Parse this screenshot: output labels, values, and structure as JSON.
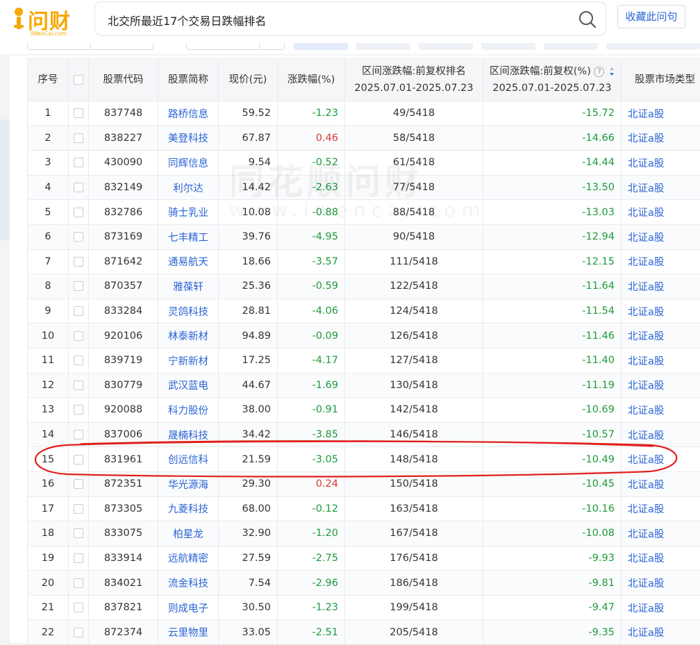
{
  "logo": {
    "text": "问财",
    "sub": "iWenCai.com"
  },
  "search": {
    "query": "北交所最近17个交易日跌幅排名"
  },
  "favorite_label": "收藏此问句",
  "table": {
    "headers": {
      "idx": "序号",
      "code": "股票代码",
      "name": "股票简称",
      "price": "现价(元)",
      "chg": "涨跌幅(%)",
      "rank_l1": "区间涨跌幅:前复权排名",
      "rank_l2": "2025.07.01-2025.07.23",
      "rng_l1": "区间涨跌幅:前复权(%)",
      "rng_l2": "2025.07.01-2025.07.23",
      "mkt": "股票市场类型"
    },
    "rows": [
      {
        "idx": "1",
        "code": "837748",
        "name": "路桥信息",
        "price": "59.52",
        "chg": "-1.23",
        "rank": "49/5418",
        "rng": "-15.72",
        "mkt": "北证a股"
      },
      {
        "idx": "2",
        "code": "838227",
        "name": "美登科技",
        "price": "67.87",
        "chg": "0.46",
        "rank": "58/5418",
        "rng": "-14.66",
        "mkt": "北证a股"
      },
      {
        "idx": "3",
        "code": "430090",
        "name": "同辉信息",
        "price": "9.54",
        "chg": "-0.52",
        "rank": "61/5418",
        "rng": "-14.44",
        "mkt": "北证a股"
      },
      {
        "idx": "4",
        "code": "832149",
        "name": "利尔达",
        "price": "14.42",
        "chg": "-2.63",
        "rank": "77/5418",
        "rng": "-13.50",
        "mkt": "北证a股"
      },
      {
        "idx": "5",
        "code": "832786",
        "name": "骑士乳业",
        "price": "10.08",
        "chg": "-0.88",
        "rank": "88/5418",
        "rng": "-13.03",
        "mkt": "北证a股"
      },
      {
        "idx": "6",
        "code": "873169",
        "name": "七丰精工",
        "price": "39.76",
        "chg": "-4.95",
        "rank": "90/5418",
        "rng": "-12.94",
        "mkt": "北证a股"
      },
      {
        "idx": "7",
        "code": "871642",
        "name": "通易航天",
        "price": "18.66",
        "chg": "-3.57",
        "rank": "111/5418",
        "rng": "-12.15",
        "mkt": "北证a股"
      },
      {
        "idx": "8",
        "code": "870357",
        "name": "雅葆轩",
        "price": "25.36",
        "chg": "-0.59",
        "rank": "122/5418",
        "rng": "-11.64",
        "mkt": "北证a股"
      },
      {
        "idx": "9",
        "code": "833284",
        "name": "灵鸽科技",
        "price": "28.81",
        "chg": "-4.06",
        "rank": "124/5418",
        "rng": "-11.54",
        "mkt": "北证a股"
      },
      {
        "idx": "10",
        "code": "920106",
        "name": "林泰新材",
        "price": "94.89",
        "chg": "-0.09",
        "rank": "126/5418",
        "rng": "-11.46",
        "mkt": "北证a股"
      },
      {
        "idx": "11",
        "code": "839719",
        "name": "宁新新材",
        "price": "17.25",
        "chg": "-4.17",
        "rank": "127/5418",
        "rng": "-11.40",
        "mkt": "北证a股"
      },
      {
        "idx": "12",
        "code": "830779",
        "name": "武汉蓝电",
        "price": "44.67",
        "chg": "-1.69",
        "rank": "130/5418",
        "rng": "-11.19",
        "mkt": "北证a股"
      },
      {
        "idx": "13",
        "code": "920088",
        "name": "科力股份",
        "price": "38.00",
        "chg": "-0.91",
        "rank": "142/5418",
        "rng": "-10.69",
        "mkt": "北证a股"
      },
      {
        "idx": "14",
        "code": "837006",
        "name": "晟楠科技",
        "price": "34.42",
        "chg": "-3.85",
        "rank": "146/5418",
        "rng": "-10.57",
        "mkt": "北证a股"
      },
      {
        "idx": "15",
        "code": "831961",
        "name": "创远信科",
        "price": "21.59",
        "chg": "-3.05",
        "rank": "148/5418",
        "rng": "-10.49",
        "mkt": "北证a股"
      },
      {
        "idx": "16",
        "code": "872351",
        "name": "华光源海",
        "price": "29.30",
        "chg": "0.24",
        "rank": "150/5418",
        "rng": "-10.45",
        "mkt": "北证a股"
      },
      {
        "idx": "17",
        "code": "873305",
        "name": "九菱科技",
        "price": "68.00",
        "chg": "-0.12",
        "rank": "163/5418",
        "rng": "-10.16",
        "mkt": "北证a股"
      },
      {
        "idx": "18",
        "code": "833075",
        "name": "柏星龙",
        "price": "32.90",
        "chg": "-1.20",
        "rank": "167/5418",
        "rng": "-10.08",
        "mkt": "北证a股"
      },
      {
        "idx": "19",
        "code": "833914",
        "name": "远航精密",
        "price": "27.59",
        "chg": "-2.75",
        "rank": "176/5418",
        "rng": "-9.93",
        "mkt": "北证a股"
      },
      {
        "idx": "20",
        "code": "834021",
        "name": "流金科技",
        "price": "7.54",
        "chg": "-2.96",
        "rank": "186/5418",
        "rng": "-9.81",
        "mkt": "北证a股"
      },
      {
        "idx": "21",
        "code": "837821",
        "name": "则成电子",
        "price": "30.50",
        "chg": "-1.23",
        "rank": "199/5418",
        "rng": "-9.47",
        "mkt": "北证a股"
      },
      {
        "idx": "22",
        "code": "872374",
        "name": "云里物里",
        "price": "33.05",
        "chg": "-2.51",
        "rank": "205/5418",
        "rng": "-9.35",
        "mkt": "北证a股"
      }
    ]
  },
  "watermark": {
    "line1": "同花顺问财",
    "line2": "www.iwencai.com"
  },
  "colors": {
    "up": "#e2352f",
    "down": "#1c9a3a",
    "link": "#2a64d6",
    "brand": "#f7a800",
    "annotation": "#e0201c"
  }
}
